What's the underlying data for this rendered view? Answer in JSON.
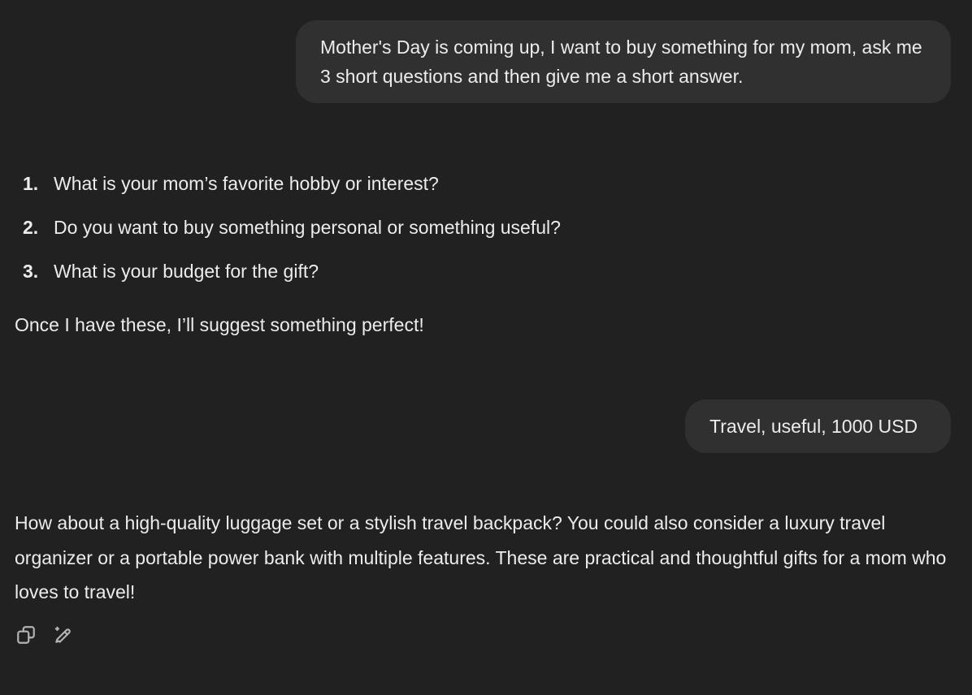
{
  "messages": {
    "user_1": "Mother's Day is coming up, I want to buy something for my mom, ask me 3 short questions and then give me a short answer.",
    "assistant_1": {
      "questions": [
        {
          "num": "1.",
          "text": "What is your mom’s favorite hobby or interest?"
        },
        {
          "num": "2.",
          "text": "Do you want to buy something personal or something useful?"
        },
        {
          "num": "3.",
          "text": "What is your budget for the gift?"
        }
      ],
      "closing": "Once I have these, I’ll suggest something perfect!"
    },
    "user_2": "Travel, useful, 1000 USD",
    "assistant_2": "How about a high-quality luggage set or a stylish travel backpack? You could also consider a luxury travel organizer or a portable power bank with multiple features. These are practical and thoughtful gifts for a mom who loves to travel!"
  },
  "actions": {
    "icons": [
      "copy-icon",
      "edit-sparkle-icon"
    ]
  },
  "colors": {
    "background": "#212121",
    "bubble": "#303030",
    "text": "#ececec",
    "icon": "#b4b4b4"
  }
}
